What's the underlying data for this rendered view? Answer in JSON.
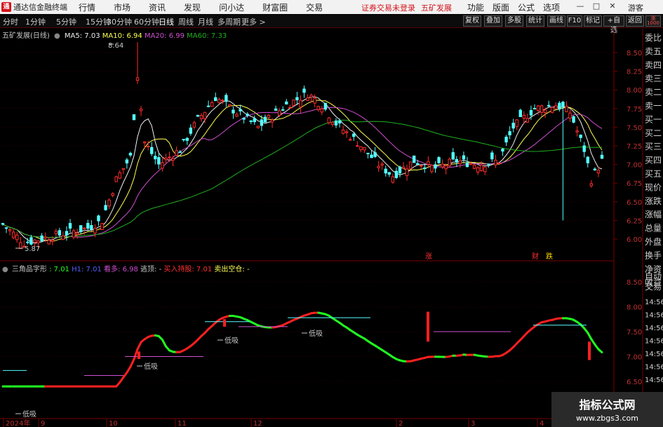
{
  "app": {
    "logo": "通",
    "title": "通达信金融终端"
  },
  "menu": [
    "行情",
    "市场",
    "资讯",
    "发现",
    "问小达",
    "财富圈",
    "交易"
  ],
  "notice": {
    "text": "证券交易未登录",
    "stock": "五矿发展"
  },
  "right_menu": [
    "功能",
    "版面",
    "公式",
    "选项"
  ],
  "guest": "游客",
  "periods": [
    "分时",
    "1分钟",
    "5分钟",
    "15分钟",
    "30分钟",
    "60分钟",
    "日线",
    "周线",
    "月线",
    "多周期",
    "更多 >"
  ],
  "active_period": "日线",
  "right_buttons": [
    "复权",
    "叠加",
    "多股",
    "统计",
    "画线",
    "F10",
    "标记",
    "+自选",
    "返回"
  ],
  "main_legend": {
    "name": "五矿发展(日线)",
    "ma5": "MA5: 7.03",
    "ma10": "MA10: 6.94",
    "ma20": "MA20: 6.99",
    "ma60": "MA60: 7.33"
  },
  "sub_legend": {
    "name": "三角品字形",
    "v1": ": 7.01",
    "v2": "H1: 7.01",
    "kd": "看多: 6.98",
    "tao": "逃顶: -",
    "buy": "买入持股: 7.01",
    "sell": "卖出空仓: -"
  },
  "colors": {
    "up": "#ff2c2c",
    "down": "#54ffff",
    "ma5": "#f0f0f0",
    "ma10": "#ffff54",
    "ma20": "#d04fd0",
    "ma60": "#20b020",
    "bull": "#ff2020",
    "bear": "#20ff20",
    "label": "#ff4444"
  },
  "price_axis": [
    "8.50",
    "8.25",
    "8.00",
    "7.75",
    "7.50",
    "7.25",
    "7.00",
    "6.75",
    "6.50",
    "6.25",
    "6.00"
  ],
  "sub_axis": [
    "8.50",
    "8.00",
    "7.50",
    "7.00",
    "6.50"
  ],
  "right_panel": [
    "委比",
    "卖五",
    "卖四",
    "卖三",
    "卖二",
    "卖一",
    "买一",
    "买二",
    "买三",
    "买四",
    "买五",
    "现价",
    "涨跌",
    "涨幅",
    "总量",
    "外盘",
    "换手",
    "净资",
    "收益"
  ],
  "right_tabs": [
    "自动",
    "交易"
  ],
  "times": [
    "14:56",
    "14:56",
    "14:56",
    "14:56",
    "14:56",
    "14:56",
    "14:56"
  ],
  "date_axis": [
    "2024年",
    "9",
    "10",
    "11",
    "12",
    "2",
    "3",
    "4"
  ],
  "peak_high": "8.64",
  "trough_low": "5.87",
  "event_labels": [
    "涨",
    "财",
    "跌"
  ],
  "annotations": [
    "低吸",
    "低吸",
    "低吸",
    "低吸"
  ],
  "watermark": {
    "line1": "指标公式网",
    "line2": "www.zbgs3.com"
  },
  "chart_data": {
    "type": "candlestick",
    "ylim": [
      5.85,
      8.7
    ],
    "sub_ylim": [
      6.3,
      8.72
    ]
  }
}
